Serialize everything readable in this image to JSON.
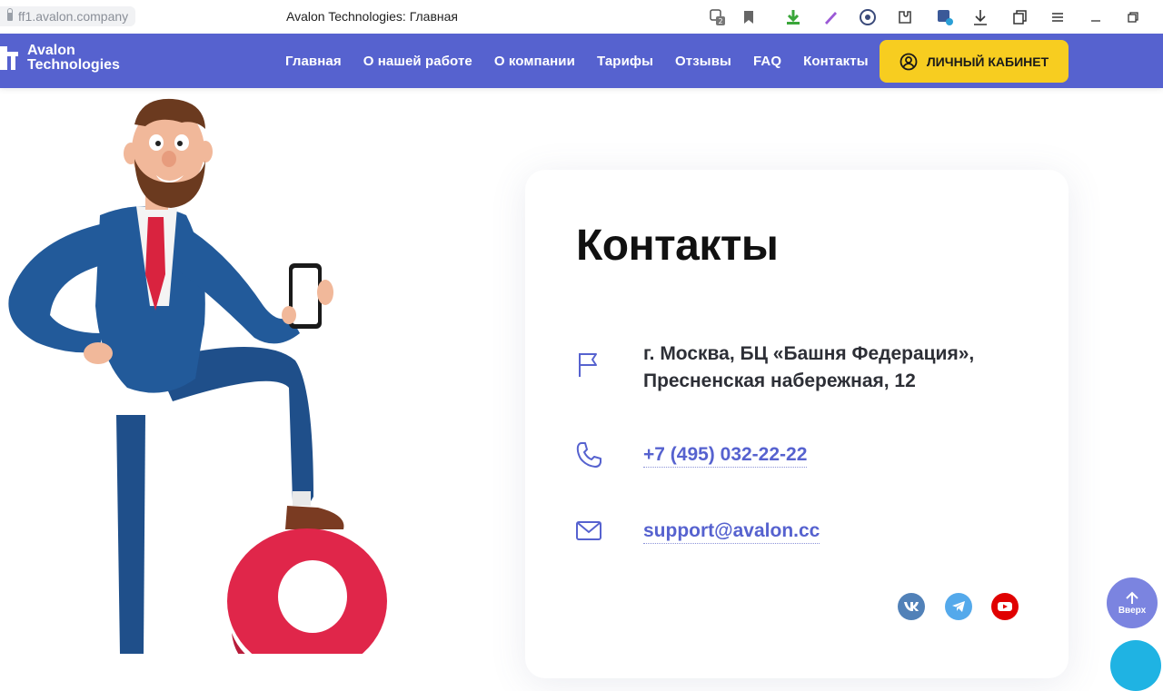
{
  "browser": {
    "url": "ff1.avalon.company",
    "tab_title": "Avalon Technologies: Главная",
    "badge_count": "2"
  },
  "nav": {
    "logo_line1": "Avalon",
    "logo_line2": "Technologies",
    "items": [
      "Главная",
      "О нашей работе",
      "О компании",
      "Тарифы",
      "Отзывы",
      "FAQ",
      "Контакты"
    ],
    "cabinet_label": "ЛИЧНЫЙ КАБИНЕТ"
  },
  "contacts": {
    "title": "Контакты",
    "address_line1": "г. Москва, БЦ «Башня Федерация»,",
    "address_line2": "Пресненская набережная, 12",
    "phone": "+7 (495) 032-22-22",
    "email": "support@avalon.cc"
  },
  "up_button": {
    "label": "Вверх"
  },
  "colors": {
    "nav_bg": "#5662cf",
    "cabinet_bg": "#f7cd20",
    "accent": "#5662cf",
    "vk": "#5181b8",
    "telegram": "#54a9eb",
    "youtube": "#e00000",
    "up_button": "#7b84e0"
  },
  "icons": {
    "address": "flag-icon",
    "phone": "phone-icon",
    "email": "mail-icon",
    "cabinet": "user-circle-icon",
    "social": [
      "vk-icon",
      "telegram-icon",
      "youtube-icon"
    ]
  }
}
